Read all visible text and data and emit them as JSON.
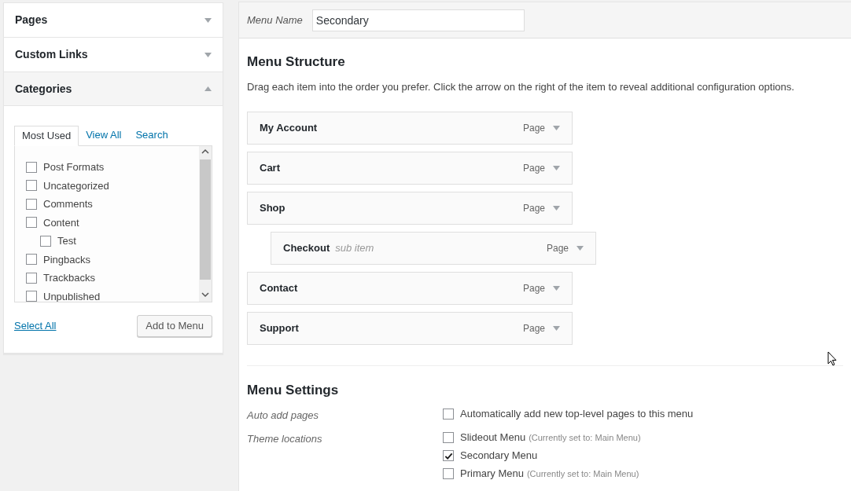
{
  "sidebar": {
    "sections": [
      {
        "title": "Pages",
        "expanded": false
      },
      {
        "title": "Custom Links",
        "expanded": false
      },
      {
        "title": "Categories",
        "expanded": true,
        "tabs": [
          {
            "label": "Most Used",
            "selected": true
          },
          {
            "label": "View All",
            "selected": false
          },
          {
            "label": "Search",
            "selected": false
          }
        ],
        "items": [
          {
            "label": "Post Formats",
            "checked": false
          },
          {
            "label": "Uncategorized",
            "checked": false
          },
          {
            "label": "Comments",
            "checked": false
          },
          {
            "label": "Content",
            "checked": false,
            "children": [
              {
                "label": "Test",
                "checked": false
              }
            ]
          },
          {
            "label": "Pingbacks",
            "checked": false
          },
          {
            "label": "Trackbacks",
            "checked": false
          },
          {
            "label": "Unpublished",
            "checked": false
          }
        ],
        "select_all": "Select All",
        "add_button": "Add to Menu"
      }
    ]
  },
  "menu_name": {
    "label": "Menu Name",
    "value": "Secondary"
  },
  "structure": {
    "title": "Menu Structure",
    "hint": "Drag each item into the order you prefer. Click the arrow on the right of the item to reveal additional configuration options.",
    "items": [
      {
        "title": "My Account",
        "type": "Page"
      },
      {
        "title": "Cart",
        "type": "Page"
      },
      {
        "title": "Shop",
        "type": "Page",
        "children": [
          {
            "title": "Checkout",
            "note": "sub item",
            "type": "Page"
          }
        ]
      },
      {
        "title": "Contact",
        "type": "Page"
      },
      {
        "title": "Support",
        "type": "Page"
      }
    ]
  },
  "settings": {
    "title": "Menu Settings",
    "rows": [
      {
        "label": "Auto add pages",
        "options": [
          {
            "label": "Automatically add new top-level pages to this menu",
            "checked": false
          }
        ]
      },
      {
        "label": "Theme locations",
        "options": [
          {
            "label": "Slideout Menu",
            "note": "(Currently set to: Main Menu)",
            "checked": false
          },
          {
            "label": "Secondary Menu",
            "checked": true
          },
          {
            "label": "Primary Menu",
            "note": "(Currently set to: Main Menu)",
            "checked": false
          }
        ]
      }
    ]
  }
}
